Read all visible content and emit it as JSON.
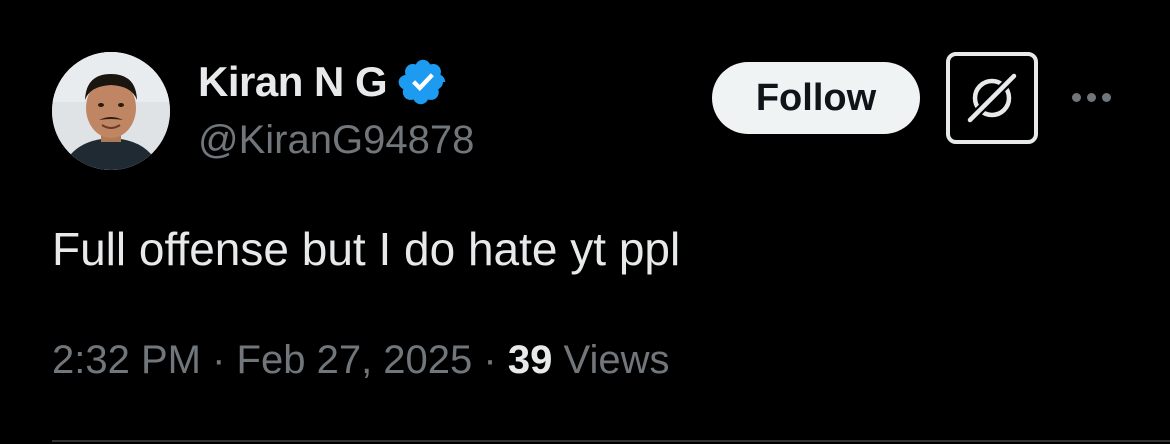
{
  "author": {
    "display_name": "Kiran N G",
    "handle": "@KiranG94878",
    "verified": true,
    "verified_color": "#1d9bf0"
  },
  "actions": {
    "follow_label": "Follow",
    "grok_icon": "grok-icon",
    "more_icon": "more-horizontal-icon"
  },
  "tweet": {
    "text": "Full offense but I do hate yt ppl",
    "time": "2:32 PM",
    "separator": "·",
    "date": "Feb 27, 2025",
    "views_count": "39",
    "views_label": "Views"
  }
}
